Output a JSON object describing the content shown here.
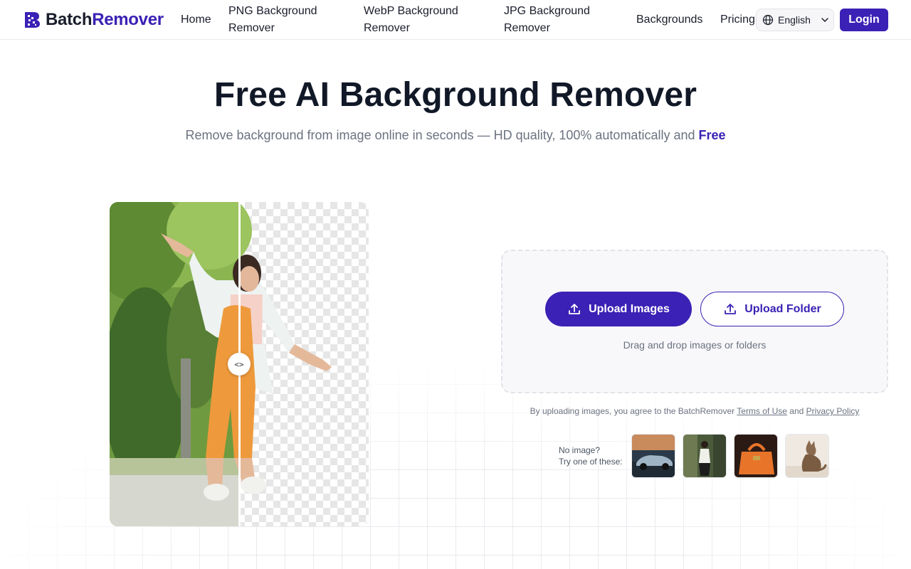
{
  "brand": {
    "part1": "Batch",
    "part2": "Remover"
  },
  "nav": {
    "home": "Home",
    "png": "PNG Background Remover",
    "webp": "WebP Background Remover",
    "jpg": "JPG Background Remover",
    "backgrounds": "Backgrounds",
    "pricing": "Pricing"
  },
  "language": {
    "selected": "English"
  },
  "login_label": "Login",
  "hero": {
    "title": "Free AI Background Remover",
    "subtitle": "Remove background from image online in seconds — HD quality, 100% automatically and",
    "subtitle_emphasis": "Free"
  },
  "compare": {
    "handle_glyph": "<>"
  },
  "upload": {
    "images_label": "Upload Images",
    "folder_label": "Upload Folder",
    "hint": "Drag and drop images or folders"
  },
  "terms": {
    "prefix": "By uploading images, you agree to the BatchRemover",
    "tos": "Terms of Use",
    "and": "and",
    "privacy": "Privacy Policy"
  },
  "samples": {
    "line1": "No image?",
    "line2": "Try one of these:",
    "items": [
      "car",
      "person",
      "handbag",
      "cat"
    ]
  },
  "colors": {
    "brand": "#3b21b5",
    "text": "#1a1d2b",
    "muted": "#6b7280"
  }
}
